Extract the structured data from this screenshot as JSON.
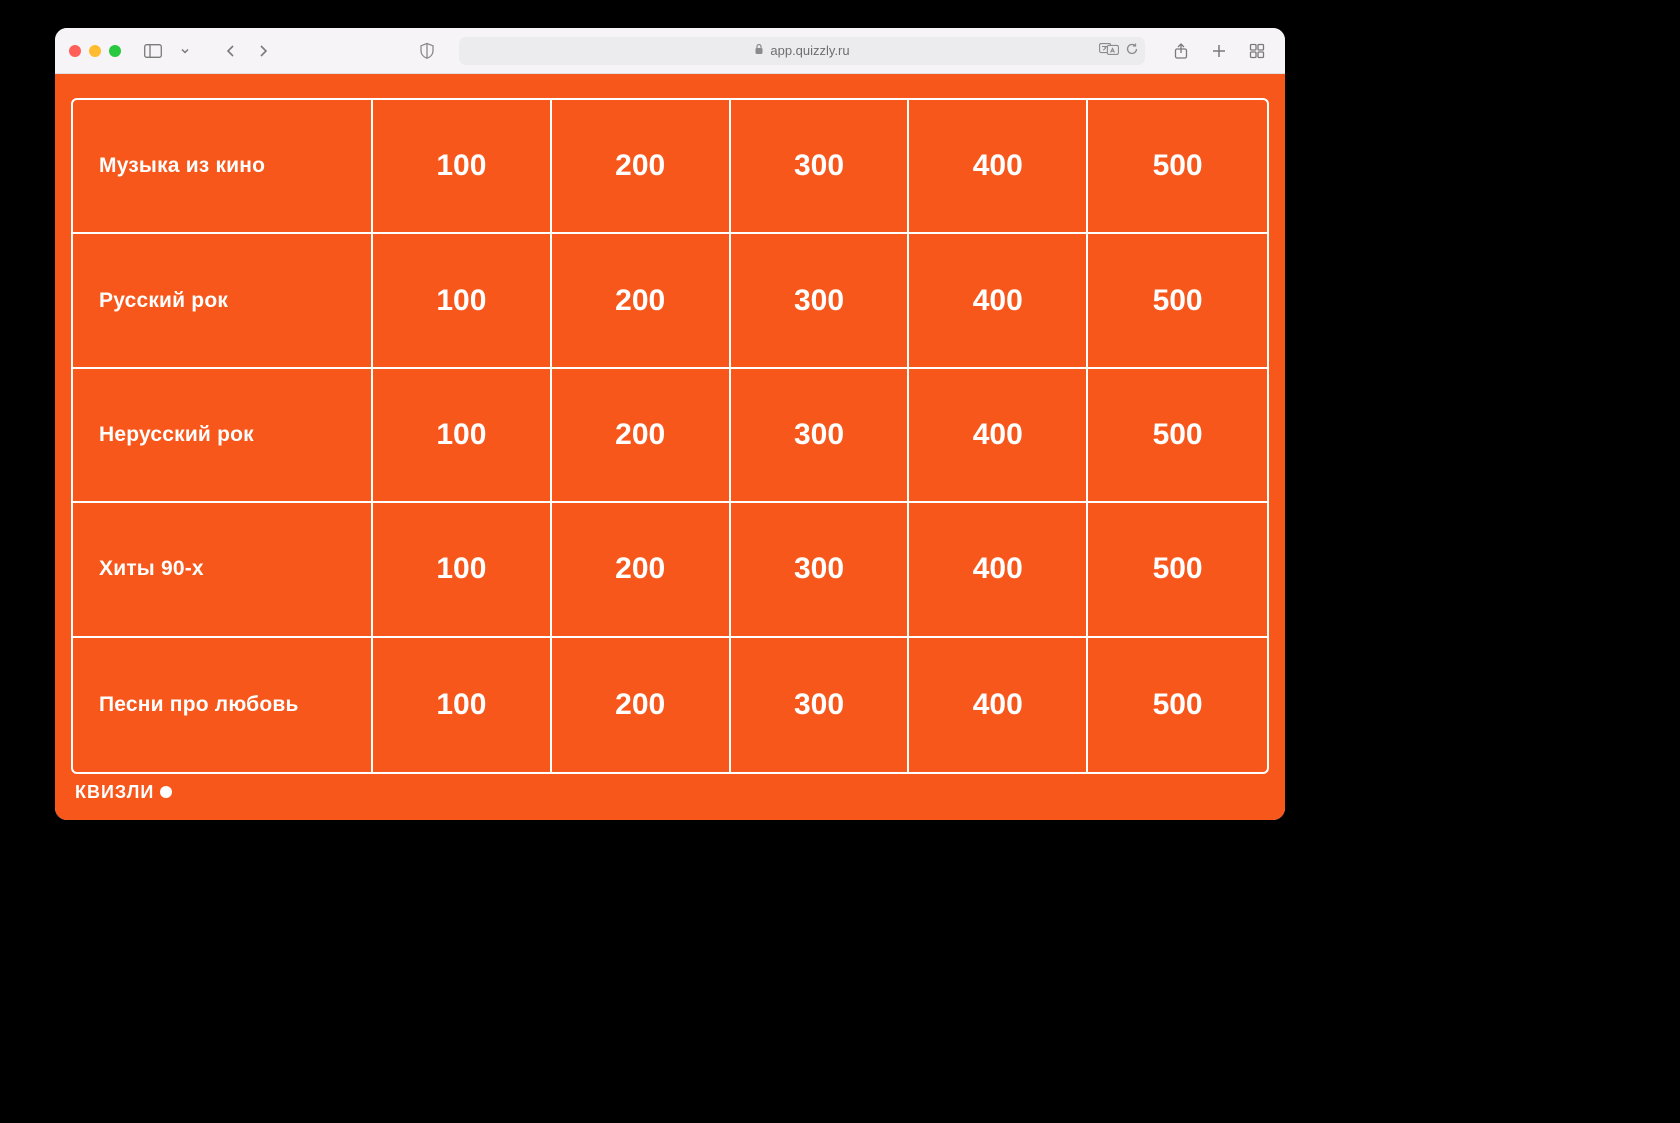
{
  "browser": {
    "url_host": "app.quizzly.ru"
  },
  "footer": {
    "brand": "КВИЗЛИ"
  },
  "colors": {
    "accent": "#f7571b",
    "text_on_accent": "#ffffff"
  },
  "board": {
    "categories": [
      "Музыка из кино",
      "Русский рок",
      "Нерусский рок",
      "Хиты 90-х",
      "Песни про любовь"
    ],
    "scores": [
      "100",
      "200",
      "300",
      "400",
      "500"
    ]
  },
  "chart_data": {
    "type": "table",
    "title": "Game board",
    "columns": [
      "Category",
      "100",
      "200",
      "300",
      "400",
      "500"
    ],
    "rows": [
      [
        "Музыка из кино",
        100,
        200,
        300,
        400,
        500
      ],
      [
        "Русский рок",
        100,
        200,
        300,
        400,
        500
      ],
      [
        "Нерусский рок",
        100,
        200,
        300,
        400,
        500
      ],
      [
        "Хиты 90-х",
        100,
        200,
        300,
        400,
        500
      ],
      [
        "Песни про любовь",
        100,
        200,
        300,
        400,
        500
      ]
    ]
  }
}
